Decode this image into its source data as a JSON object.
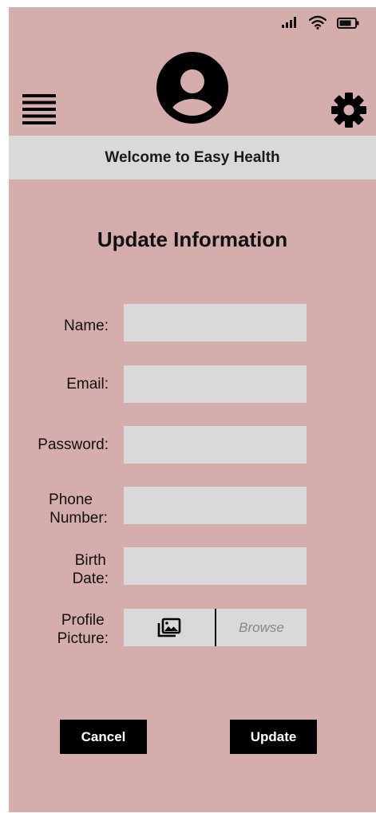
{
  "icons": {
    "signal": "signal-icon",
    "wifi": "wifi-icon",
    "battery": "battery-icon",
    "menu": "hamburger-menu-icon",
    "avatar": "user-avatar-icon",
    "settings": "gear-icon",
    "image": "image-icon"
  },
  "colors": {
    "background": "#d4adac",
    "bar": "#d9d9d9",
    "input": "#d9d9d9",
    "button": "#000000",
    "button_text": "#ffffff"
  },
  "header": {
    "welcome_text": "Welcome to Easy Health"
  },
  "form": {
    "title": "Update Information",
    "fields": [
      {
        "label": "Name:",
        "value": ""
      },
      {
        "label": "Email:",
        "value": ""
      },
      {
        "label": "Password:",
        "value": ""
      },
      {
        "label": "Phone Number:",
        "label_lines": [
          "Phone",
          "Number:"
        ],
        "value": ""
      },
      {
        "label": "Birth Date:",
        "label_lines": [
          "Birth",
          "Date:"
        ],
        "value": ""
      }
    ],
    "profile_picture": {
      "label_lines": [
        "Profile",
        "Picture:"
      ],
      "browse_label": "Browse"
    }
  },
  "buttons": {
    "cancel": "Cancel",
    "update": "Update"
  }
}
